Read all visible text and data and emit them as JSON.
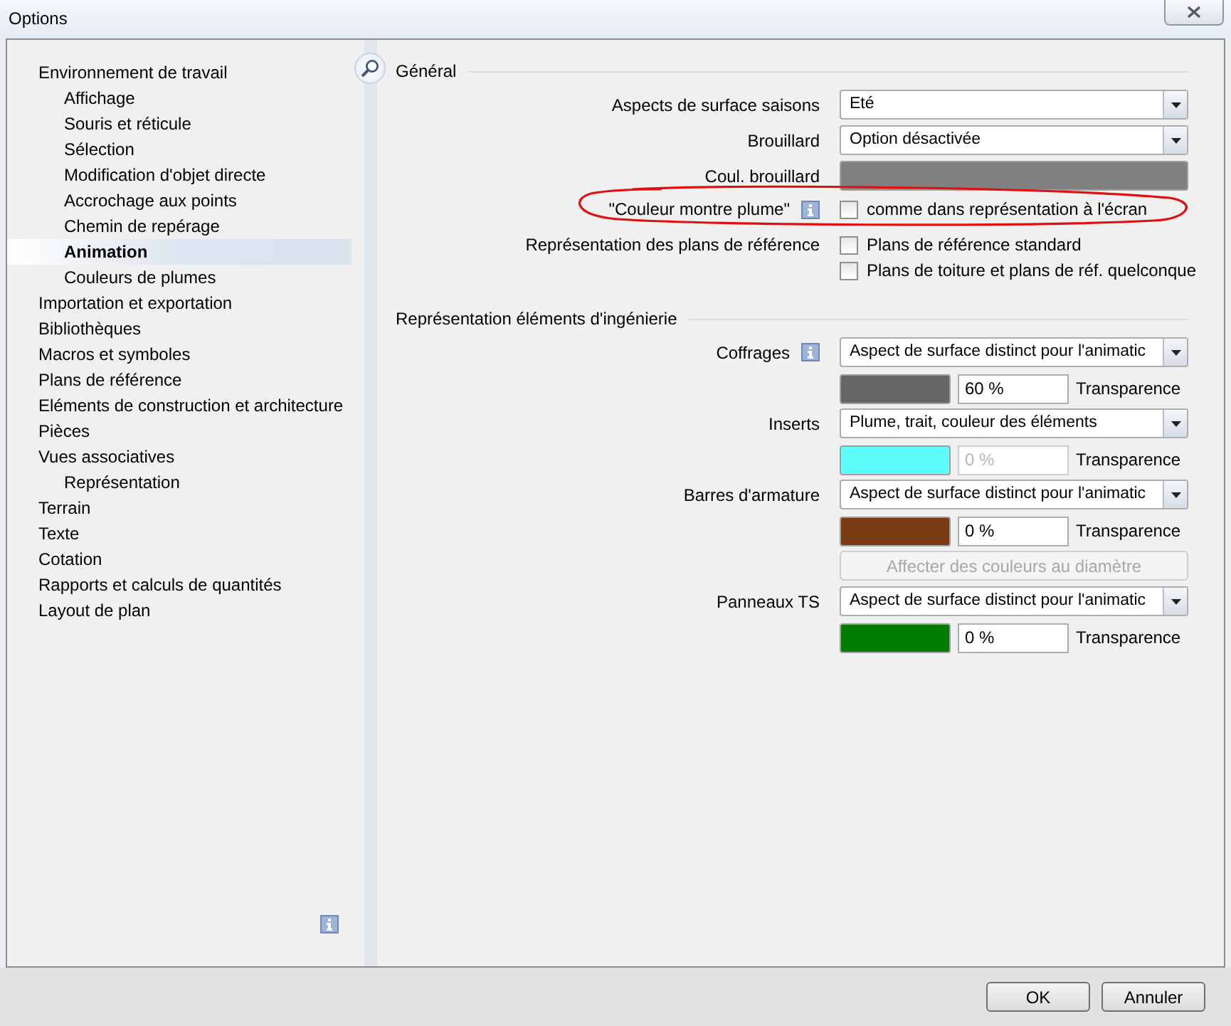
{
  "window": {
    "title": "Options"
  },
  "sidebar": {
    "items": [
      {
        "label": "Environnement de travail",
        "selected": false,
        "children": [
          {
            "label": "Affichage",
            "selected": false
          },
          {
            "label": "Souris et réticule",
            "selected": false
          },
          {
            "label": "Sélection",
            "selected": false
          },
          {
            "label": "Modification d'objet directe",
            "selected": false
          },
          {
            "label": "Accrochage aux points",
            "selected": false
          },
          {
            "label": "Chemin de repérage",
            "selected": false
          },
          {
            "label": "Animation",
            "selected": true
          },
          {
            "label": "Couleurs de plumes",
            "selected": false
          }
        ]
      },
      {
        "label": "Importation et exportation",
        "selected": false
      },
      {
        "label": "Bibliothèques",
        "selected": false
      },
      {
        "label": "Macros et symboles",
        "selected": false
      },
      {
        "label": "Plans de référence",
        "selected": false
      },
      {
        "label": "Eléments de construction et architecture",
        "selected": false
      },
      {
        "label": "Pièces",
        "selected": false
      },
      {
        "label": "Vues associatives",
        "selected": false,
        "children": [
          {
            "label": "Représentation",
            "selected": false
          }
        ]
      },
      {
        "label": "Terrain",
        "selected": false
      },
      {
        "label": "Texte",
        "selected": false
      },
      {
        "label": "Cotation",
        "selected": false
      },
      {
        "label": "Rapports et calculs de quantités",
        "selected": false
      },
      {
        "label": "Layout de plan",
        "selected": false
      }
    ]
  },
  "sections": [
    {
      "title": "Général",
      "rows": [
        {
          "kind": "select",
          "label": "Aspects de surface saisons",
          "info": false,
          "value": "Eté"
        },
        {
          "kind": "select",
          "label": "Brouillard",
          "info": false,
          "value": "Option désactivée"
        },
        {
          "kind": "color",
          "label": "Coul. brouillard",
          "info": false,
          "color": "#808080"
        },
        {
          "kind": "checkbox",
          "label": "\"Couleur montre plume\"",
          "info": true,
          "highlight": true,
          "options": [
            {
              "text": "comme dans représentation à l'écran",
              "checked": false
            }
          ]
        },
        {
          "kind": "checkbox",
          "label": "Représentation des plans de référence",
          "info": false,
          "options": [
            {
              "text": "Plans de référence standard",
              "checked": false
            },
            {
              "text": "Plans de toiture et plans de réf. quelconque",
              "checked": false
            }
          ]
        }
      ]
    },
    {
      "title": "Représentation éléments d'ingénierie",
      "rows": [
        {
          "kind": "select",
          "label": "Coffrages",
          "info": true,
          "value": "Aspect de surface distinct pour l'animatic"
        },
        {
          "kind": "swatch",
          "color": "#666666",
          "transparency": "60 %",
          "disabled": false,
          "transparency_label": "Transparence"
        },
        {
          "kind": "select",
          "label": "Inserts",
          "info": false,
          "value": "Plume, trait, couleur des éléments"
        },
        {
          "kind": "swatch",
          "color": "#5ffcfc",
          "transparency": "0 %",
          "disabled": true,
          "transparency_label": "Transparence"
        },
        {
          "kind": "select",
          "label": "Barres d'armature",
          "info": false,
          "value": "Aspect de surface distinct pour l'animatic"
        },
        {
          "kind": "swatch",
          "color": "#7b3b12",
          "transparency": "0 %",
          "disabled": false,
          "transparency_label": "Transparence"
        },
        {
          "kind": "button",
          "text": "Affecter des couleurs au diamètre",
          "disabled": true
        },
        {
          "kind": "select",
          "label": "Panneaux TS",
          "info": false,
          "value": "Aspect de surface distinct pour l'animatic"
        },
        {
          "kind": "swatch",
          "color": "#007c00",
          "transparency": "0 %",
          "disabled": false,
          "transparency_label": "Transparence"
        }
      ]
    }
  ],
  "buttons": [
    "OK",
    "Annuler"
  ]
}
